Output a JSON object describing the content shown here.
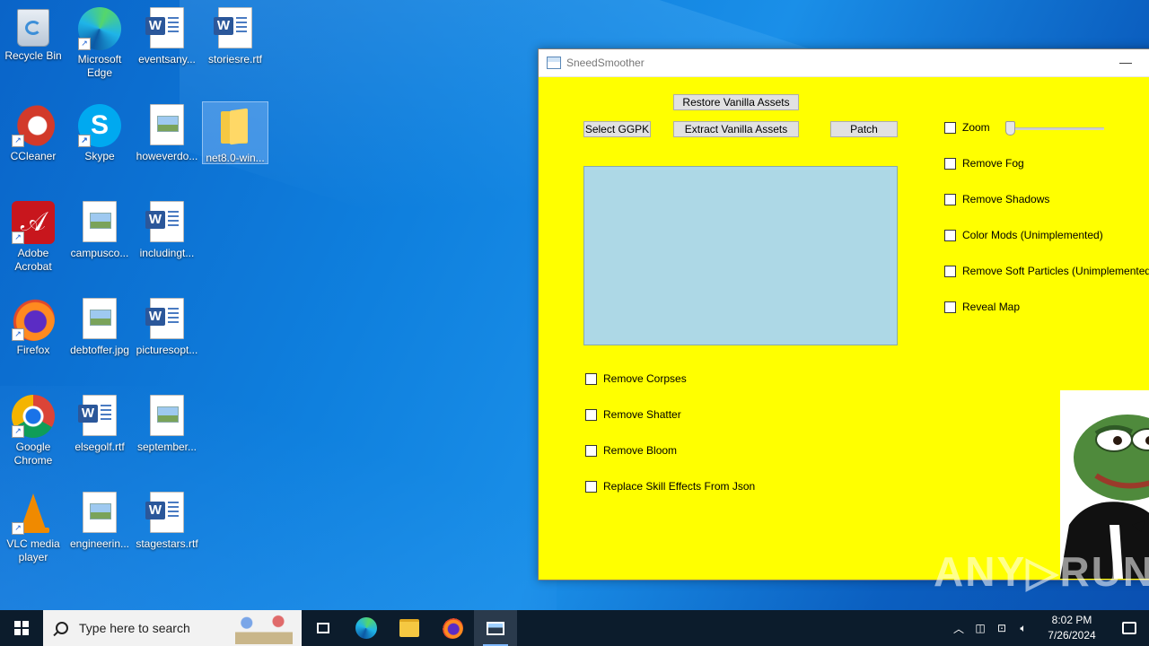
{
  "desktop": {
    "icons": [
      {
        "label": "Recycle Bin"
      },
      {
        "label": "Microsoft Edge"
      },
      {
        "label": "eventsany..."
      },
      {
        "label": "storiesre.rtf"
      },
      {
        "label": "CCleaner"
      },
      {
        "label": "Skype"
      },
      {
        "label": "howeverdo..."
      },
      {
        "label": "net8.0-win..."
      },
      {
        "label": "Adobe Acrobat"
      },
      {
        "label": "campusco..."
      },
      {
        "label": "includingt..."
      },
      {
        "label": "Firefox"
      },
      {
        "label": "debtoffer.jpg"
      },
      {
        "label": "picturesopt..."
      },
      {
        "label": "Google Chrome"
      },
      {
        "label": "elsegolf.rtf"
      },
      {
        "label": "september..."
      },
      {
        "label": "VLC media player"
      },
      {
        "label": "engineerin..."
      },
      {
        "label": "stagestars.rtf"
      }
    ]
  },
  "window": {
    "title": "SneedSmoother",
    "minimize_glyph": "—",
    "buttons": {
      "restore": "Restore Vanilla Assets",
      "select": "Select GGPK",
      "extract": "Extract Vanilla Assets",
      "patch": "Patch"
    },
    "left_options": [
      {
        "label": "Remove Corpses",
        "checked": false
      },
      {
        "label": "Remove Shatter",
        "checked": false
      },
      {
        "label": "Remove Bloom",
        "checked": false
      },
      {
        "label": "Replace Skill Effects From Json",
        "checked": false
      }
    ],
    "right_options": [
      {
        "label": "Zoom",
        "checked": false
      },
      {
        "label": "Remove Fog",
        "checked": false
      },
      {
        "label": "Remove Shadows",
        "checked": false
      },
      {
        "label": "Color Mods (Unimplemented)",
        "checked": false
      },
      {
        "label": "Remove Soft Particles (Unimplemented)",
        "checked": false
      },
      {
        "label": "Reveal Map",
        "checked": false
      }
    ],
    "zoom_slider_value": 0,
    "colors": {
      "background": "#ffff00",
      "panel": "#add8e6"
    }
  },
  "watermark": "ANY▷RUN",
  "taskbar": {
    "search_placeholder": "Type here to search",
    "time": "8:02 PM",
    "date": "7/26/2024"
  }
}
